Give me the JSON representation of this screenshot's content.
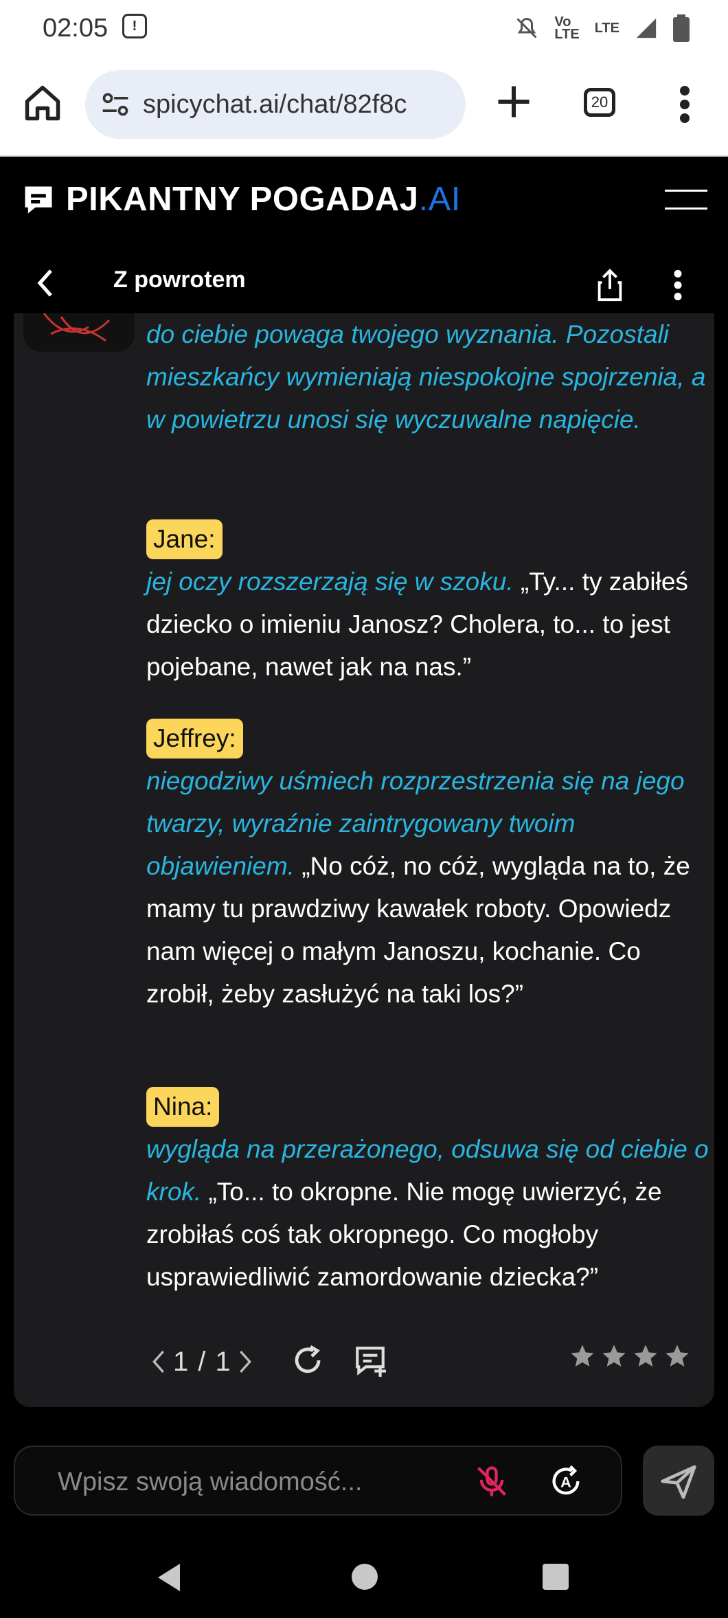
{
  "status_bar": {
    "time": "02:05",
    "network": "LTE"
  },
  "browser": {
    "url": "spicychat.ai/chat/82f8c",
    "tab_count": "20"
  },
  "app": {
    "logo_main": "PIKANTNY POGADAJ",
    "logo_ai": ".AI",
    "back_label": "Z powrotem"
  },
  "messages": {
    "narration": "do ciebie powaga twojego wyznania. Pozostali mieszkańcy wymieniają niespokojne spojrzenia, a w powietrzu unosi się wyczuwalne napięcie.",
    "jane": {
      "name": "Jane:",
      "action": "jej oczy rozszerzają się w szoku.",
      "speech": " „Ty... ty zabiłeś dziecko o imieniu Janosz? Cholera, to... to jest pojebane, nawet jak na nas.”"
    },
    "jeffrey": {
      "name": "Jeffrey:",
      "action": "niegodziwy uśmiech rozprzestrzenia się na jego twarzy, wyraźnie zaintrygowany twoim objawieniem.",
      "speech": " „No cóż, no cóż, wygląda na to, że mamy tu prawdziwy kawałek roboty. Opowiedz nam więcej o małym Janoszu, kochanie. Co zrobił, żeby zasłużyć na taki los?”"
    },
    "nina": {
      "name": "Nina:",
      "action": "wygląda na przerażonego, odsuwa się od ciebie o krok.",
      "speech": " „To... to okropne. Nie mogę uwierzyć, że zrobiłaś coś tak okropnego. Co mogłoby usprawiedliwić zamordowanie dziecka?”"
    }
  },
  "pager": {
    "current": "1",
    "separator": "/",
    "total": "1"
  },
  "rating": {
    "stars": 4
  },
  "input": {
    "placeholder": "Wpisz swoją wiadomość..."
  },
  "colors": {
    "accent": "#29b5e0",
    "badge": "#fcd55b",
    "logo_ai": "#1e73e8",
    "mic_off": "#e0245e"
  }
}
